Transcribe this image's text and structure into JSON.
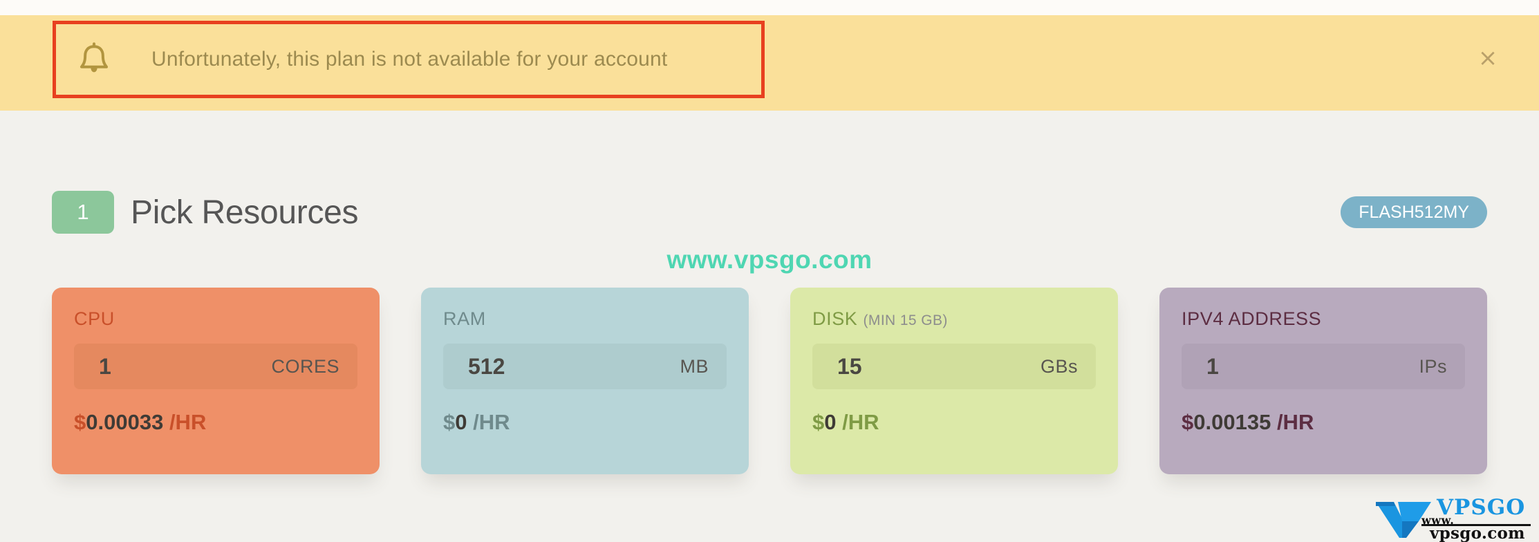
{
  "banner": {
    "icon": "bell-icon",
    "message": "Unfortunately, this plan is not available for your account",
    "close_label": "×",
    "background_color": "#fae09a",
    "text_color": "#9c8a4f",
    "highlight_border_color": "#e8401f"
  },
  "section": {
    "step_number": "1",
    "title": "Pick Resources",
    "step_badge_color": "#8cc79b",
    "plan_badge": {
      "label": "FLASH512MY",
      "color": "#7cb2c8"
    }
  },
  "watermark": {
    "text": "www.vpsgo.com",
    "color": "#4fd6b2"
  },
  "resources": [
    {
      "key": "cpu",
      "label": "CPU",
      "sublabel": "",
      "value": "1",
      "unit": "CORES",
      "currency": "$",
      "price": "0.00033",
      "period": "/HR",
      "card_color": "#ef9068",
      "accent_color": "#c9502a"
    },
    {
      "key": "ram",
      "label": "RAM",
      "sublabel": "",
      "value": "512",
      "unit": "MB",
      "currency": "$",
      "price": "0",
      "period": "/HR",
      "card_color": "#b7d5d8",
      "accent_color": "#6f8a8c"
    },
    {
      "key": "disk",
      "label": "DISK",
      "sublabel": "(MIN 15 GB)",
      "value": "15",
      "unit": "GBs",
      "currency": "$",
      "price": "0",
      "period": "/HR",
      "card_color": "#dce9a8",
      "accent_color": "#7f9b45"
    },
    {
      "key": "ipv4",
      "label": "IPV4 ADDRESS",
      "sublabel": "",
      "value": "1",
      "unit": "IPs",
      "currency": "$",
      "price": "0.00135",
      "period": "/HR",
      "card_color": "#b8aabe",
      "accent_color": "#5c2d42"
    }
  ],
  "logo": {
    "wordmark": "VPSGO",
    "www": "www.",
    "domain": "vpsgo.com",
    "mark_color": "#1a95e0"
  }
}
